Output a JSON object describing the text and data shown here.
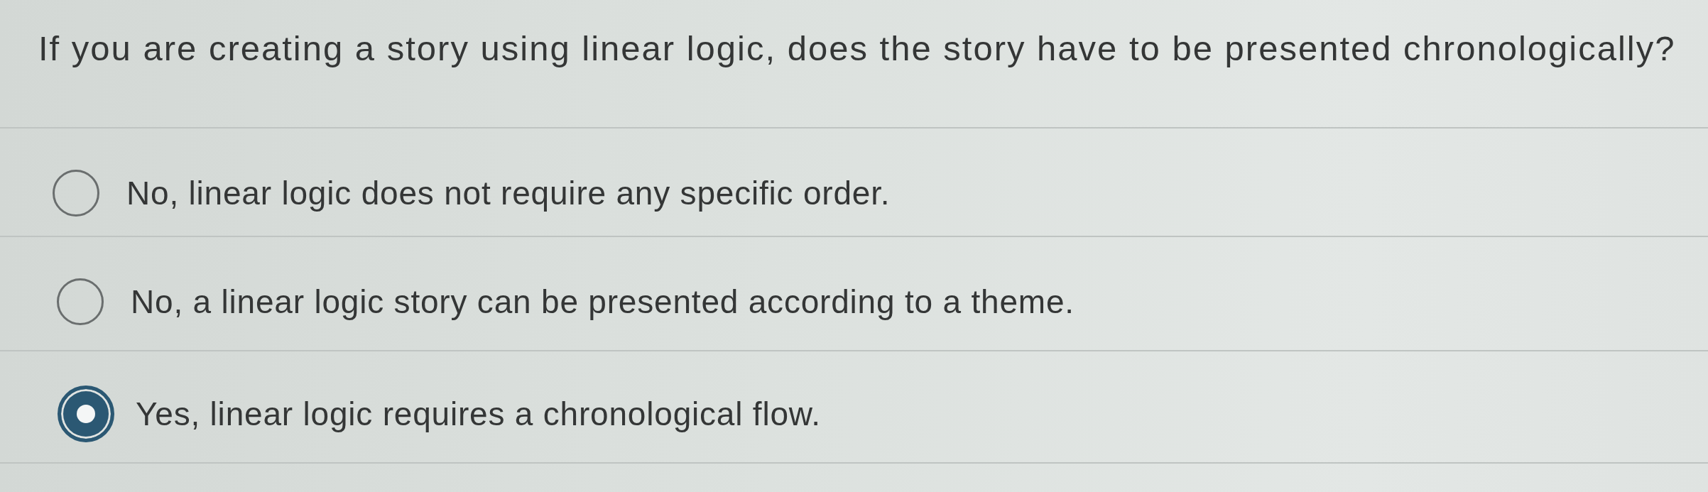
{
  "question": "If you are creating a story using linear logic, does the story have to be presented chronologically?",
  "options": [
    {
      "label": "No, linear logic does not require any specific order.",
      "selected": false
    },
    {
      "label": "No, a linear logic story can be presented according to a theme.",
      "selected": false
    },
    {
      "label": "Yes, linear logic requires a chronological flow.",
      "selected": true
    }
  ]
}
